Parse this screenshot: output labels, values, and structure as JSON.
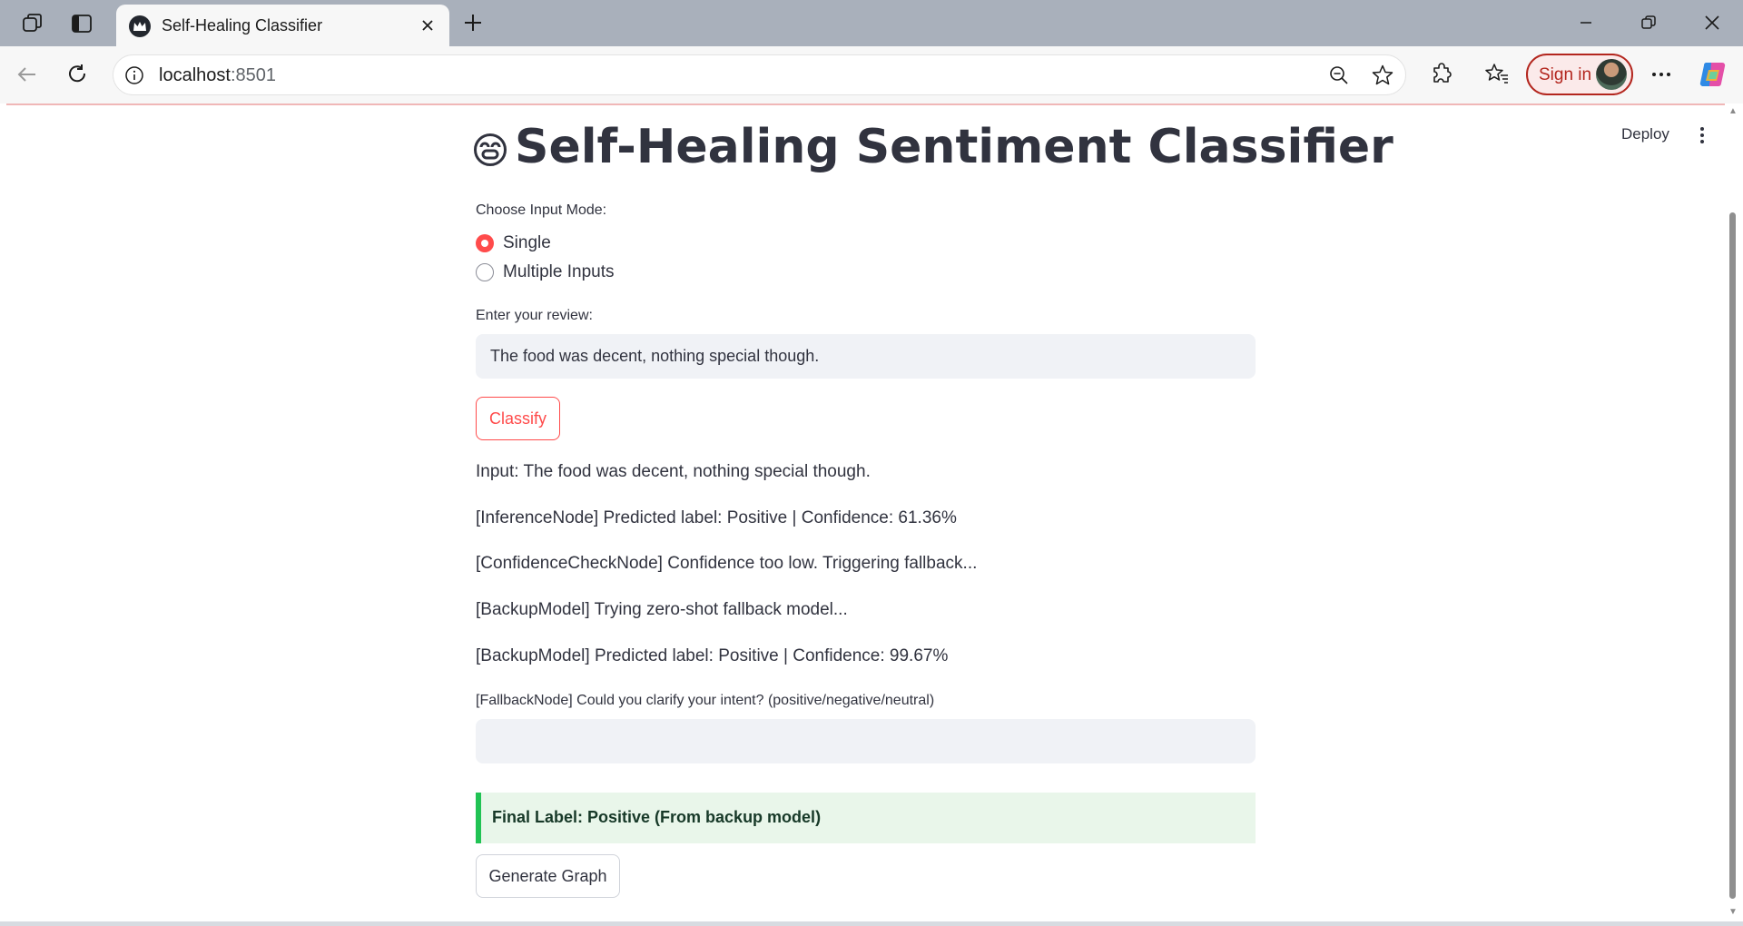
{
  "browser": {
    "tab_title": "Self-Healing Classifier",
    "address_host": "localhost",
    "address_port": ":8501",
    "signin_label": "Sign in"
  },
  "app": {
    "deploy_label": "Deploy",
    "title": "Self-Healing Sentiment Classifier",
    "input_mode_label": "Choose Input Mode:",
    "input_modes": [
      {
        "label": "Single",
        "selected": true
      },
      {
        "label": "Multiple Inputs",
        "selected": false
      }
    ],
    "review_label": "Enter your review:",
    "review_value": "The food was decent, nothing special though.",
    "classify_button": "Classify",
    "log_lines": [
      "Input: The food was decent, nothing special though.",
      "[InferenceNode] Predicted label: Positive | Confidence: 61.36%",
      "[ConfidenceCheckNode] Confidence too low. Triggering fallback...",
      "[BackupModel] Trying zero-shot fallback model...",
      "[BackupModel] Predicted label: Positive | Confidence: 99.67%"
    ],
    "fallback_prompt": "[FallbackNode] Could you clarify your intent? (positive/negative/neutral)",
    "fallback_value": "",
    "final_label": "Final Label: Positive (From backup model)",
    "generate_graph_button": "Generate Graph"
  },
  "colors": {
    "accent": "#ff4b4b",
    "success_bg": "#e9f6ea",
    "success_bar": "#21c354",
    "input_bg": "#f0f2f6"
  }
}
